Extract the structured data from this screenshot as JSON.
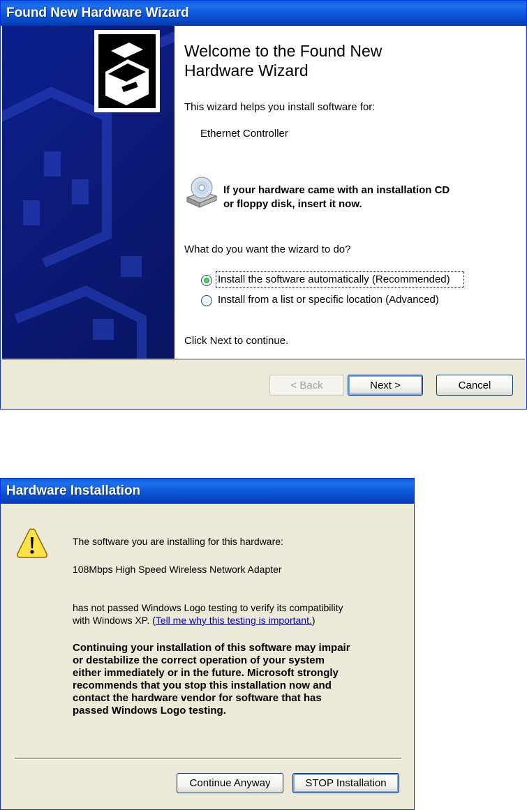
{
  "wizard": {
    "title": "Found New Hardware Wizard",
    "heading_line1": "Welcome to the Found New",
    "heading_line2": "Hardware Wizard",
    "intro": "This wizard helps you install software for:",
    "device_name": "Ethernet Controller",
    "cd_line1": "If your hardware came with an installation CD",
    "cd_line2": "or floppy disk, insert it now.",
    "question": "What do you want the wizard to do?",
    "options": [
      {
        "label": "Install the software automatically (Recommended)",
        "selected": true
      },
      {
        "label": "Install from a list or specific location (Advanced)",
        "selected": false
      }
    ],
    "continue_text": "Click Next to continue.",
    "buttons": {
      "back": "< Back",
      "next": "Next >",
      "cancel": "Cancel"
    },
    "back_enabled": false
  },
  "hwinst": {
    "title": "Hardware Installation",
    "line1": "The software you are installing for this hardware:",
    "device_name": "108Mbps High Speed Wireless Network Adapter",
    "logo_line1": "has not passed Windows Logo testing to verify its compatibility",
    "logo_line2_pre": "with Windows XP. (",
    "logo_link": "Tell me why this testing is important.",
    "logo_line2_post": ")",
    "warning_lines": [
      "Continuing your installation of this software may impair",
      "or destabilize the correct operation of your system",
      "either immediately or in the future. Microsoft strongly",
      "recommends that you stop this installation now and",
      "contact the hardware vendor for software that has",
      "passed Windows Logo testing."
    ],
    "buttons": {
      "continue": "Continue Anyway",
      "stop": "STOP Installation"
    }
  },
  "colors": {
    "titlebar": "#0a5fe6",
    "banner": "#0d1a7a",
    "dialog_bg": "#ece9d8",
    "link": "#0000cc"
  },
  "icons": {
    "wizard_banner": "hardware-box-icon",
    "cd": "cd-drive-icon",
    "warning": "warning-icon"
  }
}
